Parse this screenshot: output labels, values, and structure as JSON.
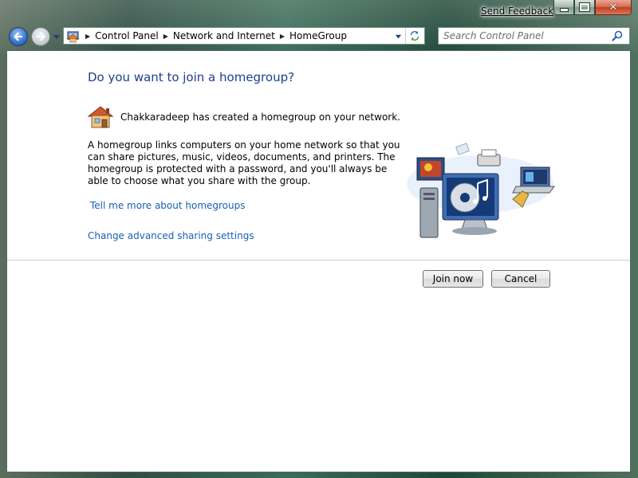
{
  "window": {
    "send_feedback": "Send Feedback",
    "caption": {
      "minimize": "minimize",
      "maximize": "maximize",
      "close": "close"
    }
  },
  "toolbar": {
    "breadcrumb": [
      "Control Panel",
      "Network and Internet",
      "HomeGroup"
    ],
    "search_placeholder": "Search Control Panel"
  },
  "main": {
    "heading": "Do you want to join a homegroup?",
    "owner_text": "Chakkaradeep has created a homegroup on your network.",
    "description": "A homegroup links computers on your home network so that you can share pictures, music, videos, documents, and printers. The homegroup is protected with a password, and you'll always be able to choose what you share with the group.",
    "link_more": "Tell me more about homegroups",
    "link_advanced": "Change advanced sharing settings"
  },
  "buttons": {
    "join": "Join now",
    "cancel": "Cancel"
  },
  "icons": {
    "back": "back-arrow-icon",
    "forward": "forward-arrow-icon",
    "home": "control-panel-home-icon",
    "refresh": "refresh-icon",
    "search": "search-icon",
    "homegroup": "house-icon"
  },
  "colors": {
    "heading": "#1e3e8e",
    "link": "#1a5fb4",
    "frame": "#2f4d42"
  }
}
